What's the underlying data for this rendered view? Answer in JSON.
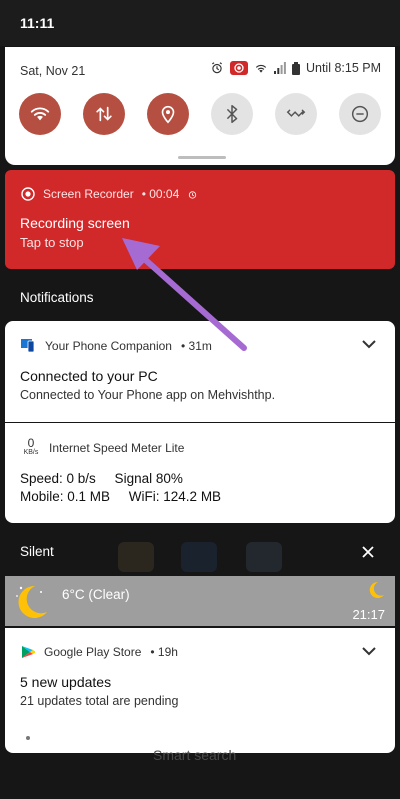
{
  "status_bar": {
    "time": "11:11"
  },
  "quick_settings": {
    "date": "Sat, Nov 21",
    "battery_text": "Until 8:15 PM",
    "tiles": [
      {
        "name": "wifi",
        "state": "on"
      },
      {
        "name": "data",
        "state": "on"
      },
      {
        "name": "location",
        "state": "on"
      },
      {
        "name": "bluetooth",
        "state": "off"
      },
      {
        "name": "auto-rotate",
        "state": "off"
      },
      {
        "name": "do-not-disturb",
        "state": "off"
      }
    ]
  },
  "recorder": {
    "app": "Screen Recorder",
    "elapsed": "• 00:04",
    "title": "Recording screen",
    "subtitle": "Tap to stop"
  },
  "notifications_label": "Notifications",
  "your_phone": {
    "app": "Your Phone Companion",
    "time": "• 31m",
    "title": "Connected to your PC",
    "body": "Connected to Your Phone app on Mehvishthp."
  },
  "speed_meter": {
    "badge_value": "0",
    "badge_unit": "KB/s",
    "app": "Internet Speed Meter Lite",
    "line1": "Speed: 0 b/s     Signal 80%",
    "line2": "Mobile: 0.1 MB     WiFi: 124.2 MB"
  },
  "silent_label": "Silent",
  "weather": {
    "text": "6°C (Clear)",
    "time": "21:17"
  },
  "play_store": {
    "app": "Google Play Store",
    "time": "• 19h",
    "title": "5 new updates",
    "body": "21 updates total are pending"
  },
  "background_text": "Smart search",
  "colors": {
    "accent_tile": "#b54f41",
    "recorder_bg": "#d1282a",
    "arrow": "#a66bd3"
  }
}
